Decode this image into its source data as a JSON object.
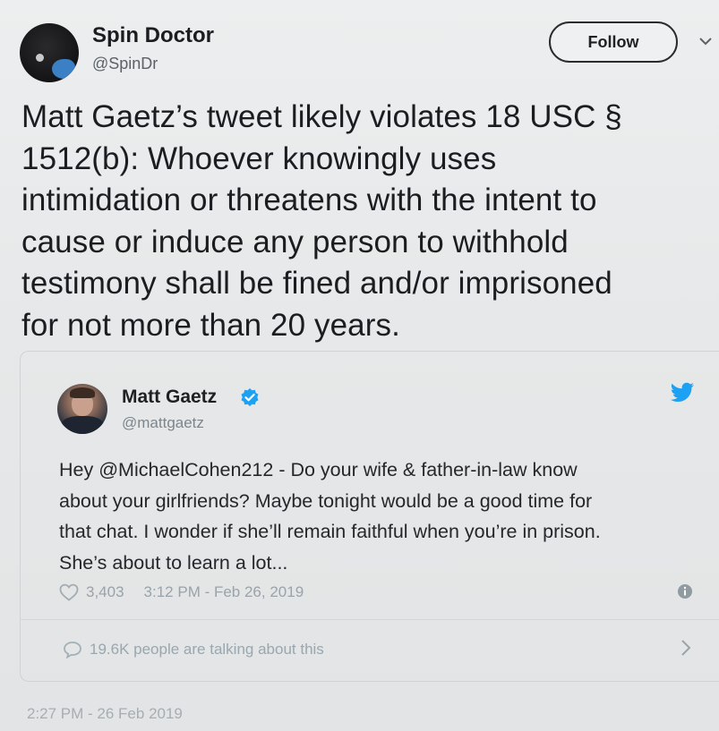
{
  "header": {
    "name": "Spin Doctor",
    "handle": "@SpinDr",
    "follow_label": "Follow"
  },
  "tweet": {
    "text": "Matt Gaetz’s tweet likely violates 18 USC § 1512(b):  Whoever knowingly uses intimidation or threatens with the intent to cause or induce any person to withhold testimony shall be fined and/or imprisoned for not more than 20 years.",
    "lines": [
      "Matt Gaetz’s tweet likely violates 18 USC §",
      "1512(b):  Whoever knowingly uses",
      "intimidation or threatens with the intent to",
      "cause or induce any person to withhold",
      "testimony shall be fined and/or imprisoned",
      "for not more than 20 years."
    ],
    "timestamp": "2:27 PM - 26 Feb 2019"
  },
  "quoted": {
    "name": "Matt Gaetz",
    "handle": "@mattgaetz",
    "lines": [
      "Hey @MichaelCohen212 - Do your wife & father-in-law know",
      "about your girlfriends? Maybe tonight would be a good time for",
      "that chat. I wonder if she’ll remain faithful when you’re in prison.",
      "She’s about to learn a lot..."
    ],
    "likes": "3,403",
    "time": "3:12 PM - Feb 26, 2019",
    "talking": "19.6K people are talking about this"
  },
  "icons": {
    "verified": "verified-badge-icon",
    "bird": "twitter-bird-icon",
    "heart": "heart-icon",
    "info": "info-icon",
    "bubble": "speech-bubble-icon",
    "chevron": "chevron-right-icon"
  },
  "colors": {
    "twitter_blue": "#1da1f2",
    "muted_text": "#9aa3a9"
  }
}
